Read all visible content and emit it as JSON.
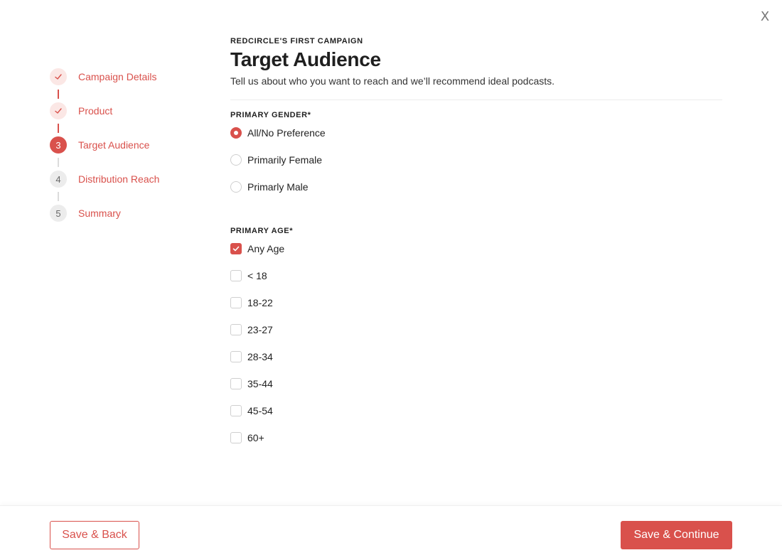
{
  "close_icon_glyph": "X",
  "accent_color": "#d9514c",
  "stepper": {
    "steps": [
      {
        "label": "Campaign Details",
        "marker": "✓",
        "state": "done"
      },
      {
        "label": "Product",
        "marker": "✓",
        "state": "done"
      },
      {
        "label": "Target Audience",
        "marker": "3",
        "state": "current"
      },
      {
        "label": "Distribution Reach",
        "marker": "4",
        "state": "todo"
      },
      {
        "label": "Summary",
        "marker": "5",
        "state": "todo"
      }
    ]
  },
  "header": {
    "eyebrow": "REDCIRCLE'S FIRST CAMPAIGN",
    "title": "Target Audience",
    "subtitle": "Tell us about who you want to reach and we’ll recommend ideal podcasts."
  },
  "gender": {
    "label": "PRIMARY GENDER*",
    "options": [
      {
        "label": "All/No Preference",
        "checked": true
      },
      {
        "label": "Primarily Female",
        "checked": false
      },
      {
        "label": "Primarly Male",
        "checked": false
      }
    ]
  },
  "age": {
    "label": "PRIMARY AGE*",
    "options": [
      {
        "label": "Any Age",
        "checked": true
      },
      {
        "label": "< 18",
        "checked": false
      },
      {
        "label": "18-22",
        "checked": false
      },
      {
        "label": "23-27",
        "checked": false
      },
      {
        "label": "28-34",
        "checked": false
      },
      {
        "label": "35-44",
        "checked": false
      },
      {
        "label": "45-54",
        "checked": false
      },
      {
        "label": "60+",
        "checked": false
      }
    ]
  },
  "footer": {
    "back_label": "Save & Back",
    "continue_label": "Save & Continue"
  }
}
